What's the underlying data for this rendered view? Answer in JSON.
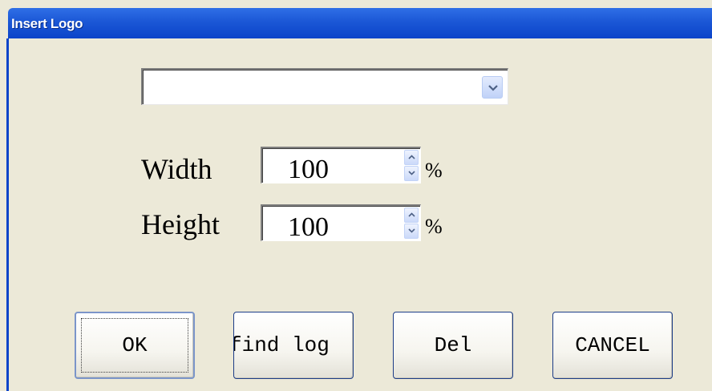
{
  "window": {
    "title": "Insert Logo"
  },
  "logo_select": {
    "value": ""
  },
  "width_field": {
    "label": "Width",
    "value": "100",
    "unit": "%"
  },
  "height_field": {
    "label": "Height",
    "value": "100",
    "unit": "%"
  },
  "buttons": {
    "ok": "OK",
    "find_logo": "find log",
    "delete": "Del",
    "cancel": "CANCEL"
  },
  "icons": {
    "dropdown": "chevron-down-icon",
    "spin_up": "chevron-up-icon",
    "spin_down": "chevron-down-icon"
  },
  "colors": {
    "titlebar": "#0b44c9",
    "dialog_bg": "#ece9d8",
    "button_border": "#1c3c87"
  }
}
